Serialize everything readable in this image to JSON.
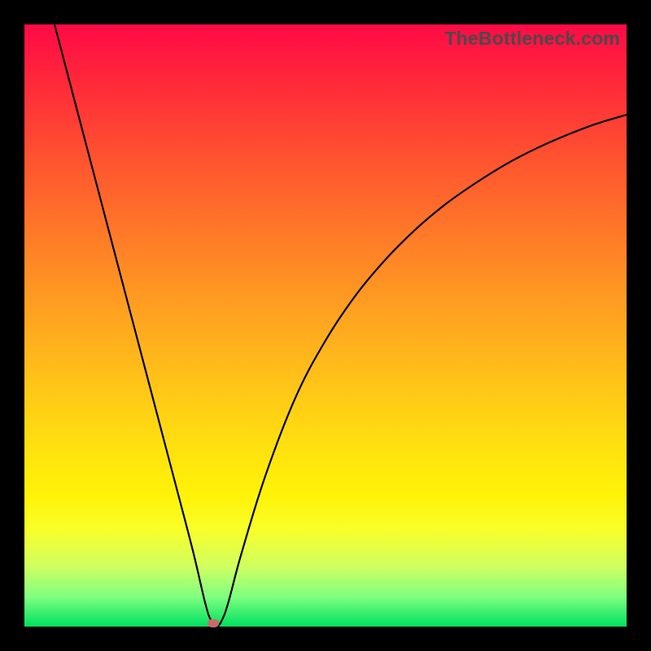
{
  "watermark": "TheBottleneck.com",
  "chart_data": {
    "type": "line",
    "title": "",
    "xlabel": "",
    "ylabel": "",
    "xlim": [
      0,
      100
    ],
    "ylim": [
      0,
      100
    ],
    "grid": false,
    "legend": false,
    "series": [
      {
        "name": "curve",
        "color": "#000000",
        "x": [
          5,
          10,
          15,
          20,
          25,
          28,
          30,
          31,
          32,
          33,
          34,
          36,
          40,
          45,
          50,
          55,
          60,
          65,
          70,
          75,
          80,
          85,
          90,
          95,
          100
        ],
        "values": [
          100,
          81,
          62,
          43,
          24,
          12.5,
          4,
          1,
          0,
          1.5,
          4.5,
          12,
          25,
          38,
          47.5,
          55,
          61,
          66,
          70.2,
          73.7,
          76.8,
          79.4,
          81.6,
          83.5,
          85
        ]
      }
    ],
    "marker": {
      "x": 31.3,
      "y": 0.5,
      "color": "#cc6a6a"
    }
  }
}
